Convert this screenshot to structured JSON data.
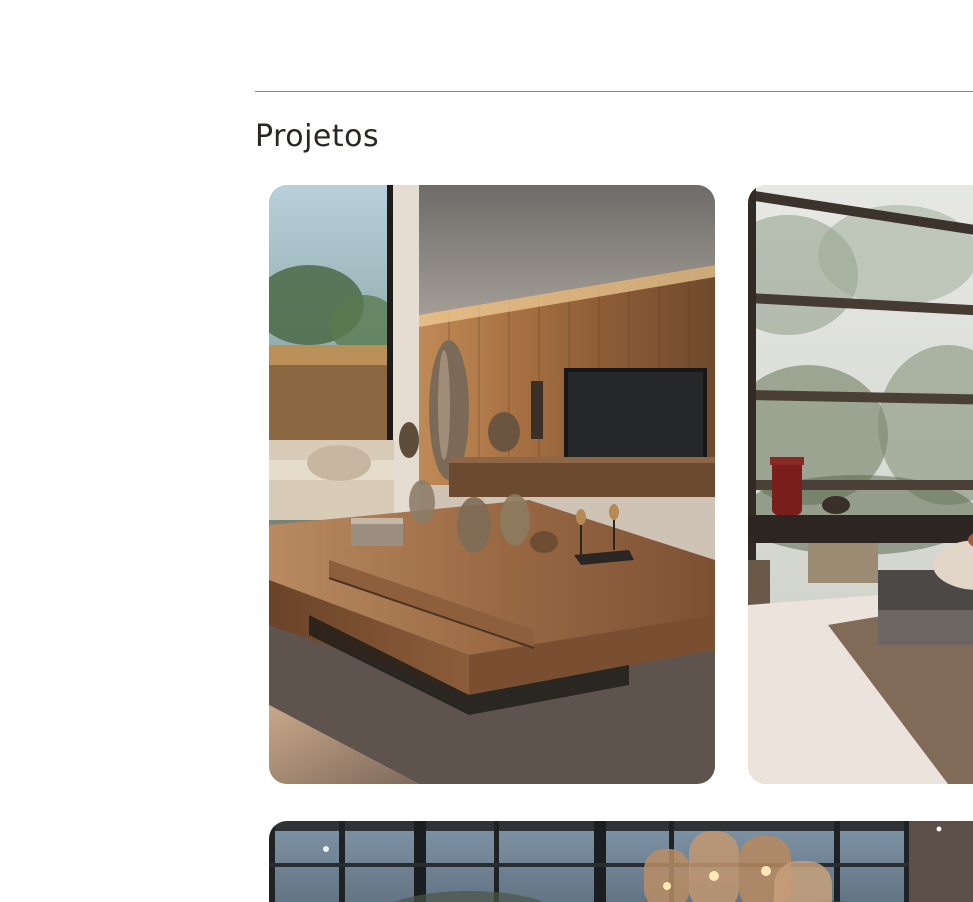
{
  "section": {
    "title": "Projetos"
  },
  "projects": [
    {
      "image": "living-room-wood-panel-tv"
    },
    {
      "image": "living-room-glass-garden"
    },
    {
      "image": "dining-room-pendant-lights"
    }
  ],
  "colors": {
    "title_text": "#2a2622",
    "divider": "#8b8b8b",
    "background": "#ffffff"
  }
}
